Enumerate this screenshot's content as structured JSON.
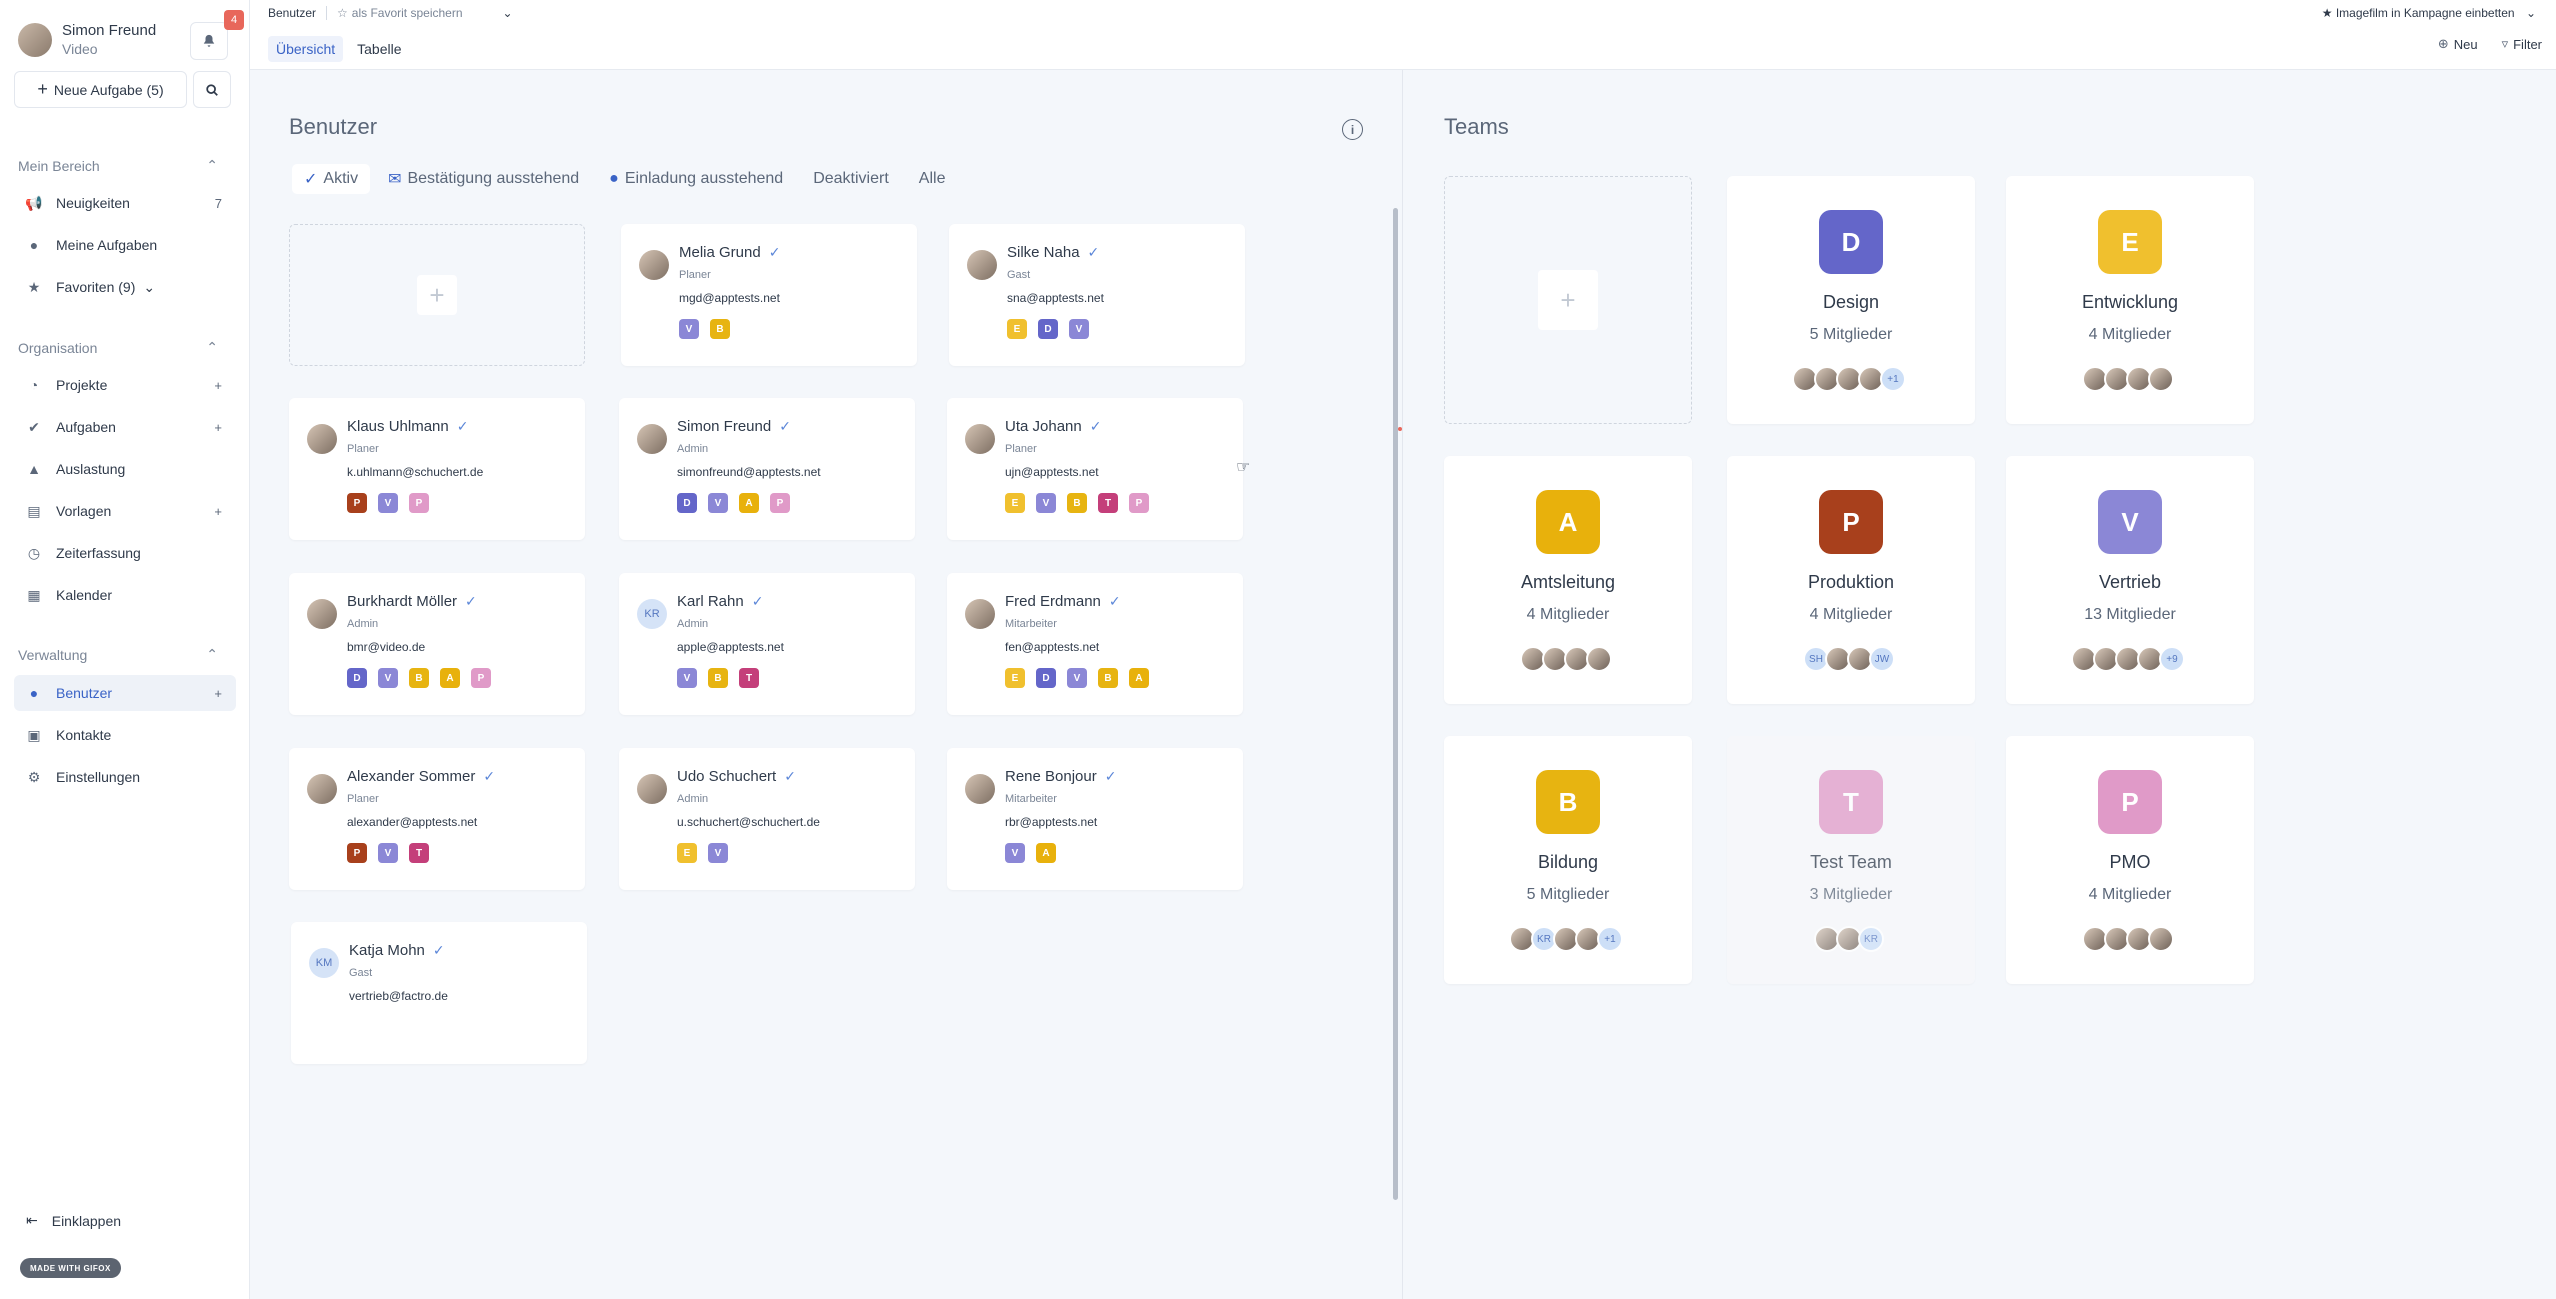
{
  "sidebar": {
    "user_name": "Simon Freund",
    "user_sub": "Video",
    "notification_count": "4",
    "new_task_label": "Neue Aufgabe (5)",
    "sections": {
      "mein_bereich": "Mein Bereich",
      "organisation": "Organisation",
      "verwaltung": "Verwaltung"
    },
    "items": {
      "neuigkeiten": {
        "label": "Neuigkeiten",
        "count": "7"
      },
      "meine_aufgaben": {
        "label": "Meine Aufgaben"
      },
      "favoriten": {
        "label": "Favoriten (9)"
      },
      "projekte": {
        "label": "Projekte"
      },
      "aufgaben": {
        "label": "Aufgaben"
      },
      "auslastung": {
        "label": "Auslastung"
      },
      "vorlagen": {
        "label": "Vorlagen"
      },
      "zeiterfassung": {
        "label": "Zeiterfassung"
      },
      "kalender": {
        "label": "Kalender"
      },
      "benutzer": {
        "label": "Benutzer"
      },
      "kontakte": {
        "label": "Kontakte"
      },
      "einstellungen": {
        "label": "Einstellungen"
      }
    },
    "collapse_label": "Einklappen",
    "made_with": "MADE WITH GIFOX"
  },
  "topbar": {
    "breadcrumb": "Benutzer",
    "favorite_label": "als Favorit speichern",
    "tabs": [
      "Übersicht",
      "Tabelle"
    ],
    "campaign": "Imagefilm in Kampagne einbetten",
    "new_label": "Neu",
    "filter_label": "Filter"
  },
  "users_panel": {
    "title": "Benutzer",
    "filters": [
      "Aktiv",
      "Bestätigung ausstehend",
      "Einladung ausstehend",
      "Deaktiviert",
      "Alle"
    ]
  },
  "users": [
    {
      "name": "Melia Grund",
      "role": "Planer",
      "email": "mgd@apptests.net",
      "chips": [
        "V",
        "B"
      ]
    },
    {
      "name": "Silke Naha",
      "role": "Gast",
      "email": "sna@apptests.net",
      "chips": [
        "E",
        "D",
        "V"
      ]
    },
    {
      "name": "Klaus Uhlmann",
      "role": "Planer",
      "email": "k.uhlmann@schuchert.de",
      "chips": [
        "P",
        "V",
        "P"
      ]
    },
    {
      "name": "Simon Freund",
      "role": "Admin",
      "email": "simonfreund@apptests.net",
      "chips": [
        "D",
        "V",
        "A",
        "P"
      ]
    },
    {
      "name": "Uta Johann",
      "role": "Planer",
      "email": "ujn@apptests.net",
      "chips": [
        "E",
        "V",
        "B",
        "T",
        "P"
      ]
    },
    {
      "name": "Burkhardt Möller",
      "role": "Admin",
      "email": "bmr@video.de",
      "chips": [
        "D",
        "V",
        "B",
        "A",
        "P"
      ]
    },
    {
      "name": "Karl Rahn",
      "initials": "KR",
      "role": "Admin",
      "email": "apple@apptests.net",
      "chips": [
        "V",
        "B",
        "T"
      ]
    },
    {
      "name": "Fred Erdmann",
      "role": "Mitarbeiter",
      "email": "fen@apptests.net",
      "chips": [
        "E",
        "D",
        "V",
        "B",
        "A"
      ]
    },
    {
      "name": "Alexander Sommer",
      "role": "Planer",
      "email": "alexander@apptests.net",
      "chips": [
        "P",
        "V",
        "T"
      ]
    },
    {
      "name": "Udo Schuchert",
      "role": "Admin",
      "email": "u.schuchert@schuchert.de",
      "chips": [
        "E",
        "V"
      ]
    },
    {
      "name": "Rene Bonjour",
      "role": "Mitarbeiter",
      "email": "rbr@apptests.net",
      "chips": [
        "V",
        "A"
      ]
    },
    {
      "name": "Katja Mohn",
      "initials": "KM",
      "role": "Gast",
      "email": "vertrieb@factro.de",
      "chips": []
    }
  ],
  "teams_panel": {
    "title": "Teams"
  },
  "teams": [
    {
      "letter": "D",
      "name": "Design",
      "count": "5 Mitglieder",
      "members": [
        "",
        "",
        "",
        "",
        "+1"
      ],
      "muted": false
    },
    {
      "letter": "E",
      "name": "Entwicklung",
      "count": "4 Mitglieder",
      "members": [
        "",
        "",
        "",
        ""
      ],
      "muted": false
    },
    {
      "letter": "A",
      "name": "Amtsleitung",
      "count": "4 Mitglieder",
      "members": [
        "",
        "",
        "",
        ""
      ],
      "muted": false
    },
    {
      "letter": "P",
      "name": "Produktion",
      "count": "4 Mitglieder",
      "members": [
        "SH",
        "",
        "",
        "JW"
      ],
      "muted": false
    },
    {
      "letter": "V",
      "name": "Vertrieb",
      "count": "13 Mitglieder",
      "members": [
        "",
        "",
        "",
        "",
        "+9"
      ],
      "muted": false
    },
    {
      "letter": "B",
      "name": "Bildung",
      "count": "5 Mitglieder",
      "members": [
        "",
        "KR",
        "",
        "",
        "+1"
      ],
      "muted": false
    },
    {
      "letter": "T",
      "name": "Test Team",
      "count": "3 Mitglieder",
      "members": [
        "",
        "",
        "KR"
      ],
      "muted": true
    },
    {
      "letter": "P",
      "name": "PMO",
      "count": "4 Mitglieder",
      "members": [
        "",
        "",
        "",
        ""
      ],
      "muted": false
    }
  ],
  "colors": {
    "D": "#6466c9",
    "E": "#f0c02e",
    "V": "#8b87d6",
    "B": "#e7b411",
    "A": "#e8b10c",
    "P": "#e09ac8",
    "T": "#c43f7a",
    "P_prod": "#a8401c",
    "accent": "#3a63c6"
  }
}
